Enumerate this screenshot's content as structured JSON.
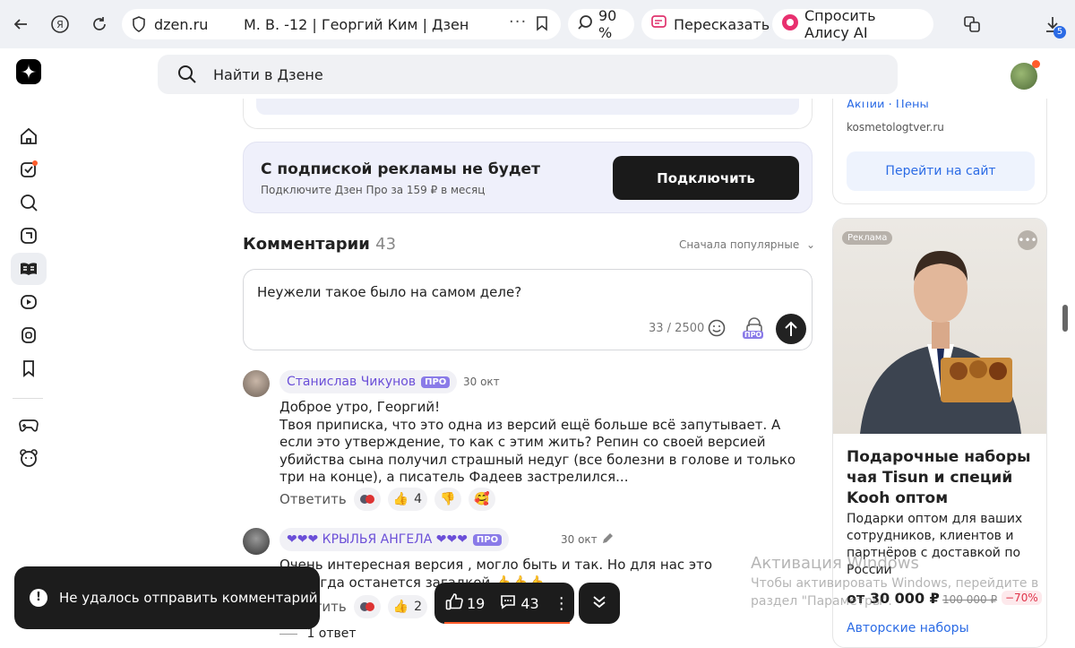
{
  "browser": {
    "domain": "dzen.ru",
    "tab_title": "М. В. -12 | Георгий Ким | Дзен",
    "zoom": "90 %",
    "retell_label": "Пересказать",
    "alice_label": "Спросить Алису AI",
    "downloads_badge": "5"
  },
  "header": {
    "search_placeholder": "Найти в Дзене"
  },
  "subscription_promo": {
    "heading": "С подпиской рекламы не будет",
    "subtext": "Подключите Дзен Про за 159 ₽ в месяц",
    "button_label": "Подключить"
  },
  "comments": {
    "heading": "Комментарии",
    "count": "43",
    "sort_label": "Сначала популярные",
    "compose_text": "Неужели такое было на самом деле?",
    "compose_counter": "33 / 2500",
    "pro_label": "ПРО",
    "items": [
      {
        "author": "Станислав Чикунов",
        "badge": "ПРО",
        "date": "30 окт",
        "text": "Доброе утро, Георгий!\nТвоя приписка, что это одна из версий ещё больше всё запутывает. А если это утверждение, то как с этим жить? Репин со своей версией убийства сына получил страшный недуг (все болезни в голове и только три на конце), а писатель Фадеев застрелился...",
        "reply_label": "Ответить",
        "likes": "4"
      },
      {
        "author": "❤❤❤ КРЫЛЬЯ АНГЕЛА ❤❤❤",
        "badge": "ПРО",
        "date": "30 окт",
        "text": "Очень интересная версия , могло быть и так. Но для нас это навсегда останется загадкой.👍👍👍",
        "reply_label": "Ответить",
        "likes": "2",
        "replies_label": "1 ответ"
      }
    ]
  },
  "ads": {
    "top_cut_text": "Акции · Цены",
    "top_domain": "kosmetologtver.ru",
    "top_button": "Перейти на сайт",
    "label": "Реклама",
    "title": "Подарочные наборы чая Tisun и специй Kooh оптом",
    "description": "Подарки оптом для ваших сотрудников, клиентов и партнёров с доставкой по России",
    "price": "от 30 000 ₽",
    "old_price": "100 000 ₽",
    "discount": "−70%",
    "link": "Авторские наборы"
  },
  "watermark": {
    "line1": "Активация Windows",
    "line2": "Чтобы активировать Windows, перейдите в раздел \"Параметры\"."
  },
  "toast": {
    "message": "Не удалось отправить комментарий"
  },
  "float_bar": {
    "likes": "19",
    "comments": "43"
  },
  "colors": {
    "accent_blue": "#2b6be5",
    "pro_purple": "#8a7be8",
    "name_purple": "#6b4fd8",
    "dark": "#1c1c1c",
    "orange_dot": "#ff5c2b",
    "discount_red": "#e0344a"
  }
}
